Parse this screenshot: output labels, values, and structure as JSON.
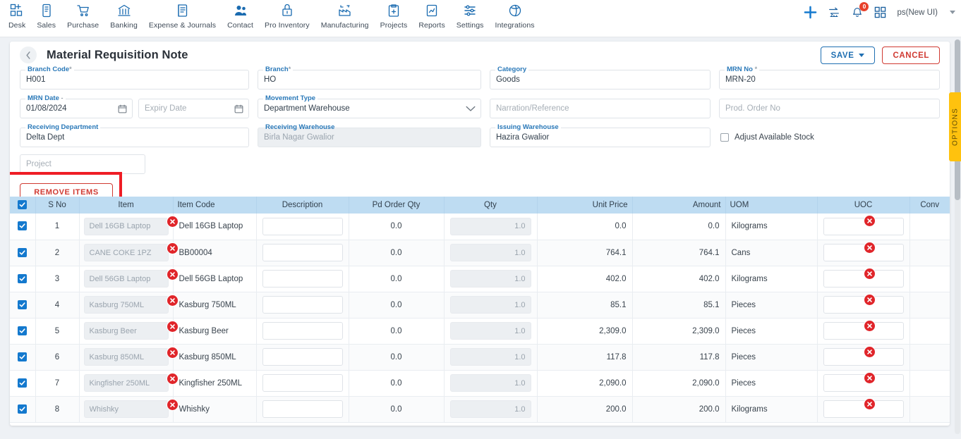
{
  "topnav": {
    "items": [
      {
        "label": "Desk",
        "icon": "desk-icon"
      },
      {
        "label": "Sales",
        "icon": "sales-icon"
      },
      {
        "label": "Purchase",
        "icon": "purchase-cart-icon"
      },
      {
        "label": "Banking",
        "icon": "bank-icon"
      },
      {
        "label": "Expense & Journals",
        "icon": "journal-book-icon"
      },
      {
        "label": "Contact",
        "icon": "contact-people-icon"
      },
      {
        "label": "Pro Inventory",
        "icon": "inventory-icon"
      },
      {
        "label": "Manufacturing",
        "icon": "factory-icon"
      },
      {
        "label": "Projects",
        "icon": "projects-clipboard-icon"
      },
      {
        "label": "Reports",
        "icon": "reports-chart-icon"
      },
      {
        "label": "Settings",
        "icon": "settings-sliders-icon"
      },
      {
        "label": "Integrations",
        "icon": "integrations-icon"
      }
    ],
    "notification_count": "0",
    "user": "ps(New UI)"
  },
  "header": {
    "title": "Material Requisition Note",
    "back": "‹",
    "save_label": "SAVE",
    "cancel_label": "CANCEL"
  },
  "form": {
    "branch_code": {
      "label": "Branch Code",
      "required": "*",
      "value": "H001"
    },
    "branch": {
      "label": "Branch",
      "required": "*",
      "value": "HO"
    },
    "category": {
      "label": "Category",
      "value": "Goods"
    },
    "mrn_no": {
      "label": "MRN No",
      "required": "*",
      "value": "MRN-20"
    },
    "mrn_date": {
      "label": "MRN Date",
      "required": "-",
      "value": "01/08/2024"
    },
    "expiry_date": {
      "placeholder": "Expiry Date",
      "value": ""
    },
    "movement_type": {
      "label": "Movement Type",
      "value": "Department Warehouse"
    },
    "narration": {
      "placeholder": "Narration/Reference",
      "value": ""
    },
    "prod_order_no": {
      "placeholder": "Prod. Order No",
      "value": ""
    },
    "receiving_department": {
      "label": "Receiving Department",
      "value": "Delta Dept"
    },
    "receiving_warehouse": {
      "label": "Receiving Warehouse",
      "value": "Birla Nagar Gwalior"
    },
    "issuing_warehouse": {
      "label": "Issuing Warehouse",
      "value": "Hazira Gwalior"
    },
    "adjust_available_stock": {
      "label": "Adjust Available Stock",
      "checked": false
    },
    "project": {
      "placeholder": "Project",
      "value": ""
    },
    "remove_items_label": "REMOVE ITEMS"
  },
  "options_tab": {
    "label": "OPTIONS"
  },
  "table": {
    "columns": [
      "",
      "S No",
      "Item",
      "Item Code",
      "Description",
      "Pd Order Qty",
      "Qty",
      "Unit Price",
      "Amount",
      "UOM",
      "UOC",
      "Conv"
    ],
    "rows": [
      {
        "checked": true,
        "sno": "1",
        "item": "Dell 16GB Laptop",
        "code": "Dell 16GB Laptop",
        "desc": "",
        "pdq": "0.0",
        "qty": "1.0",
        "unit": "0.0",
        "amount": "0.0",
        "uom": "Kilograms",
        "uoc": ""
      },
      {
        "checked": true,
        "sno": "2",
        "item": "CANE COKE 1PZ",
        "code": "BB00004",
        "desc": "",
        "pdq": "0.0",
        "qty": "1.0",
        "unit": "764.1",
        "amount": "764.1",
        "uom": "Cans",
        "uoc": ""
      },
      {
        "checked": true,
        "sno": "3",
        "item": "Dell 56GB Laptop",
        "code": "Dell 56GB Laptop",
        "desc": "",
        "pdq": "0.0",
        "qty": "1.0",
        "unit": "402.0",
        "amount": "402.0",
        "uom": "Kilograms",
        "uoc": ""
      },
      {
        "checked": true,
        "sno": "4",
        "item": "Kasburg 750ML",
        "code": "Kasburg 750ML",
        "desc": "",
        "pdq": "0.0",
        "qty": "1.0",
        "unit": "85.1",
        "amount": "85.1",
        "uom": "Pieces",
        "uoc": ""
      },
      {
        "checked": true,
        "sno": "5",
        "item": "Kasburg Beer",
        "code": "Kasburg Beer",
        "desc": "",
        "pdq": "0.0",
        "qty": "1.0",
        "unit": "2,309.0",
        "amount": "2,309.0",
        "uom": "Pieces",
        "uoc": ""
      },
      {
        "checked": true,
        "sno": "6",
        "item": "Kasburg 850ML",
        "code": "Kasburg 850ML",
        "desc": "",
        "pdq": "0.0",
        "qty": "1.0",
        "unit": "117.8",
        "amount": "117.8",
        "uom": "Pieces",
        "uoc": ""
      },
      {
        "checked": true,
        "sno": "7",
        "item": "Kingfisher 250ML",
        "code": "Kingfisher 250ML",
        "desc": "",
        "pdq": "0.0",
        "qty": "1.0",
        "unit": "2,090.0",
        "amount": "2,090.0",
        "uom": "Pieces",
        "uoc": ""
      },
      {
        "checked": true,
        "sno": "8",
        "item": "Whishky",
        "code": "Whishky",
        "desc": "",
        "pdq": "0.0",
        "qty": "1.0",
        "unit": "200.0",
        "amount": "200.0",
        "uom": "Kilograms",
        "uoc": ""
      }
    ]
  },
  "colors": {
    "accent_blue": "#2978b8",
    "danger_red": "#d03a32",
    "header_blue": "#bedcf2",
    "annotation_red": "#ef1d25",
    "options_yellow": "#ffc20e"
  }
}
